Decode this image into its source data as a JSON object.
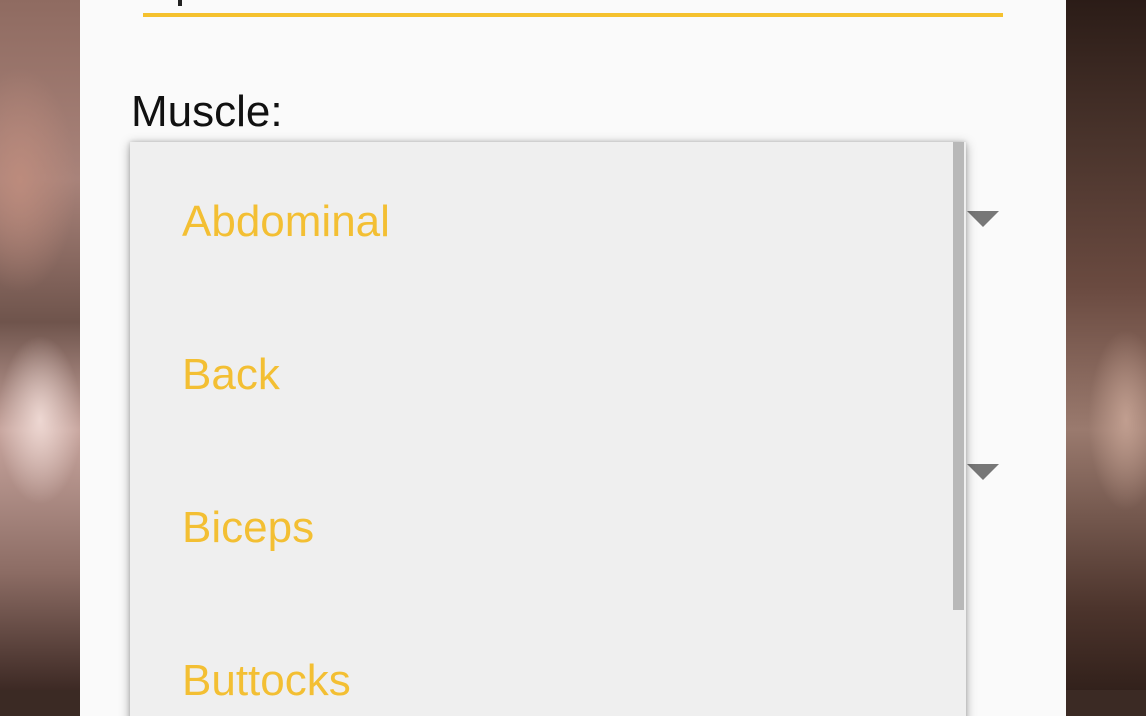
{
  "form": {
    "muscle_label": "Muscle:"
  },
  "dropdown": {
    "options": [
      "Abdominal",
      "Back",
      "Biceps",
      "Buttocks"
    ]
  },
  "colors": {
    "accent": "#f3bf33",
    "dialog_background": "#fafafa",
    "dropdown_background": "#efefef",
    "label_text": "#111111"
  },
  "icons": {
    "spinner_arrow": "triangle-down"
  }
}
